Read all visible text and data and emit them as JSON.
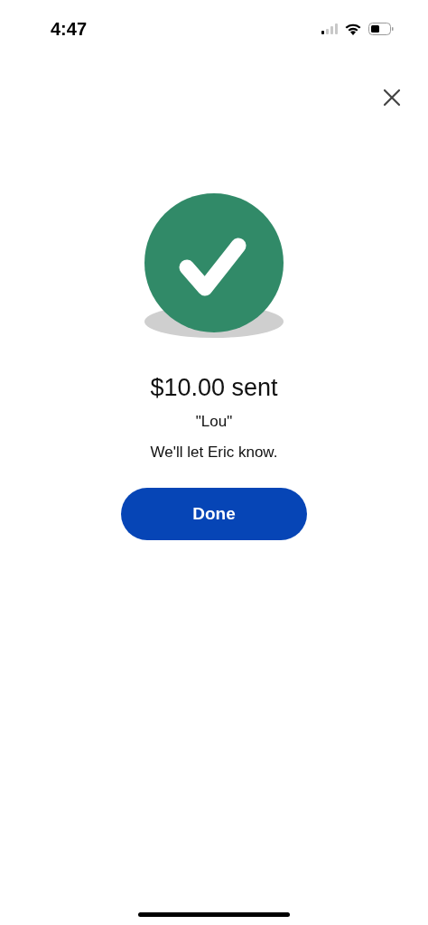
{
  "status_bar": {
    "time": "4:47"
  },
  "confirmation": {
    "amount_title": "$10.00 sent",
    "note": "\"Lou\"",
    "message": "We'll let Eric know."
  },
  "buttons": [
    {
      "label": "Done"
    }
  ]
}
